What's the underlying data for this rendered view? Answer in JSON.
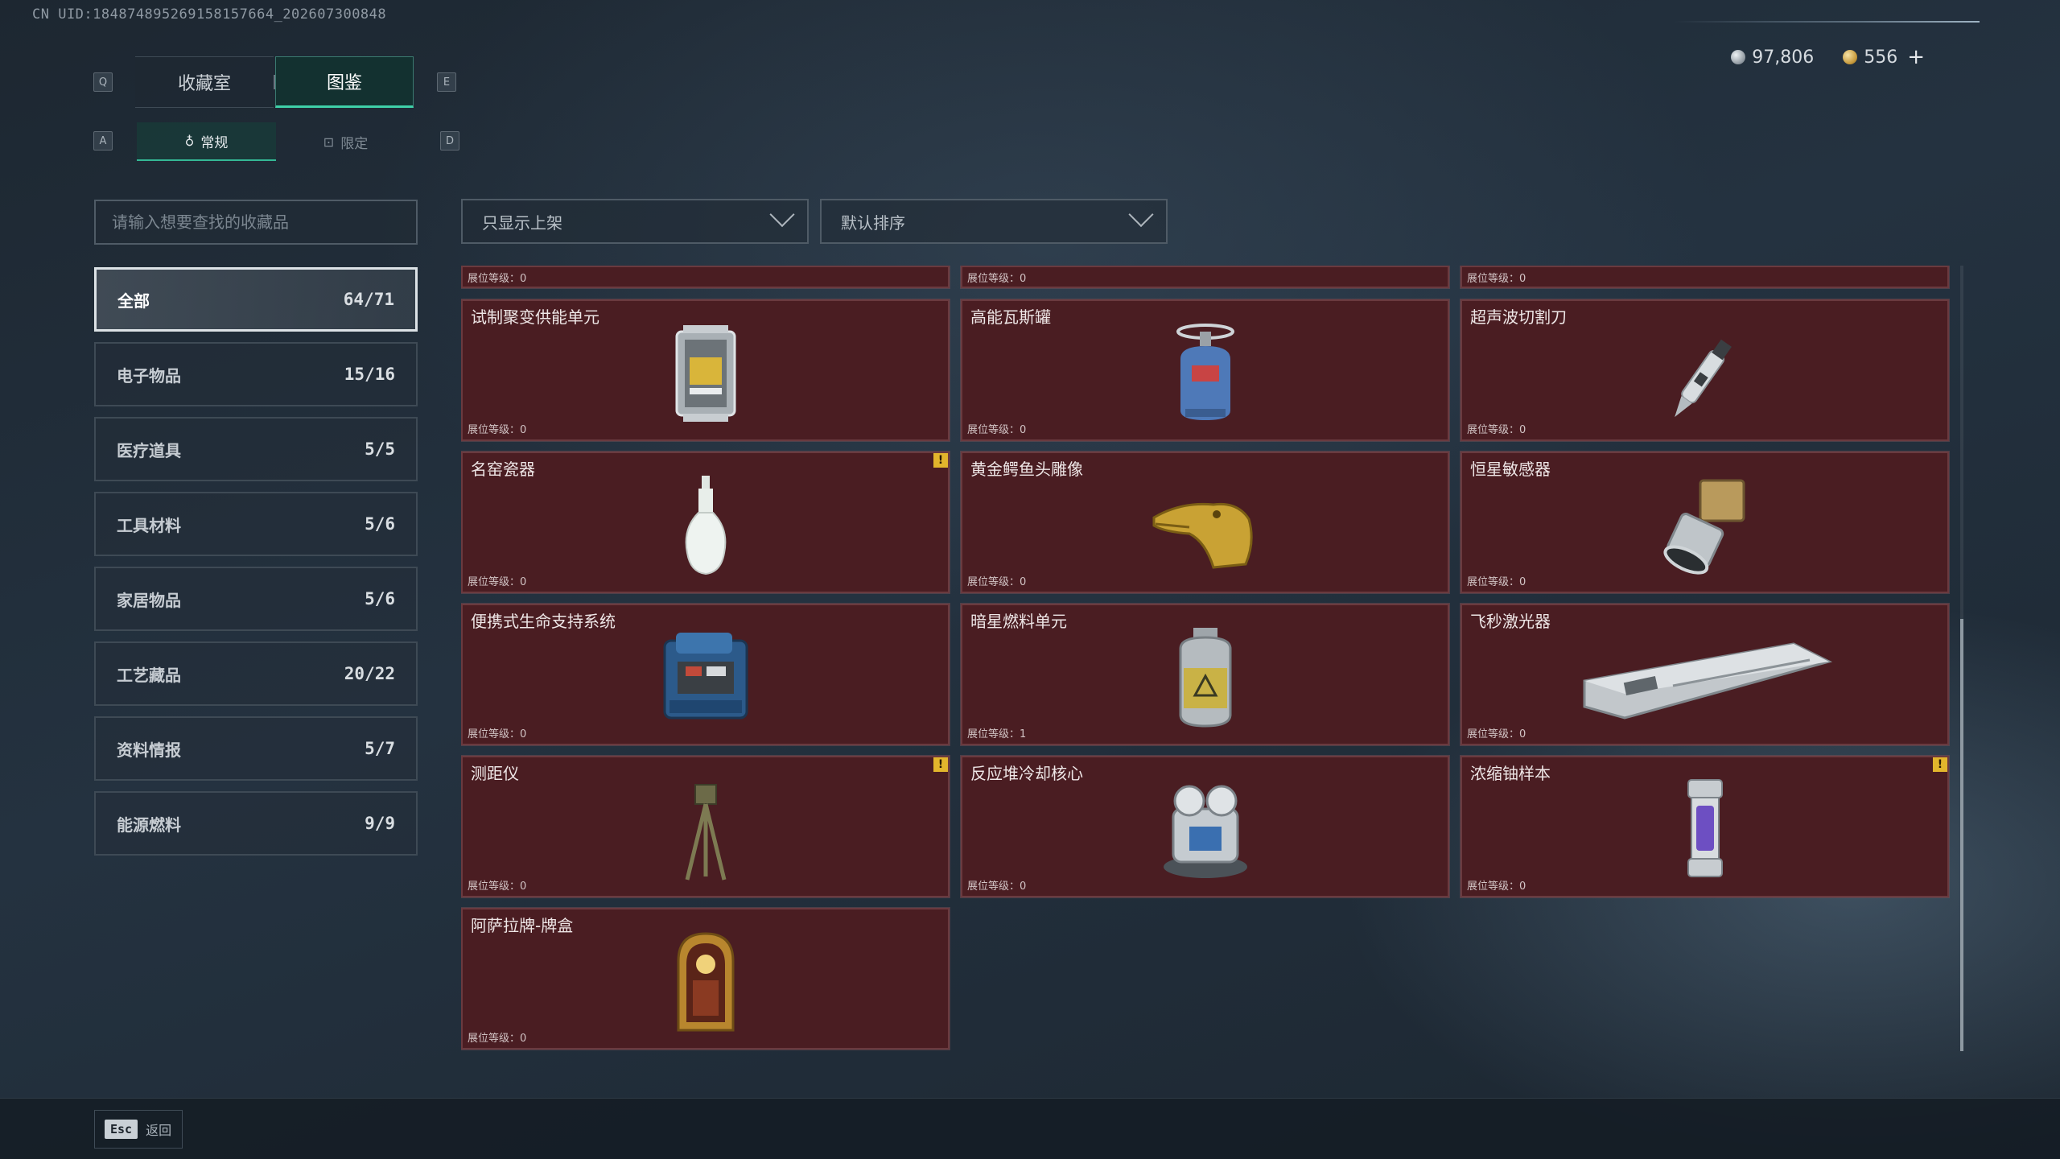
{
  "uid_text": "CN UID:18487489526915815766​4_202607300848",
  "currency": {
    "silver": "97,806",
    "gold": "556",
    "plus": "+"
  },
  "keys": {
    "q": "Q",
    "e": "E",
    "a": "A",
    "d": "D"
  },
  "top_tabs": [
    {
      "label": "收藏室",
      "active": false
    },
    {
      "label": "图鉴",
      "active": true
    }
  ],
  "sub_tabs": [
    {
      "label": "常规",
      "icon": "♁",
      "active": true
    },
    {
      "label": "限定",
      "icon": "⊡",
      "active": false
    }
  ],
  "search": {
    "placeholder": "请输入想要查找的收藏品"
  },
  "filters": {
    "shelf": "只显示上架",
    "sort": "默认排序"
  },
  "categories": [
    {
      "label": "全部",
      "count": "64/71",
      "active": true
    },
    {
      "label": "电子物品",
      "count": "15/16"
    },
    {
      "label": "医疗道具",
      "count": "5/5"
    },
    {
      "label": "工具材料",
      "count": "5/6"
    },
    {
      "label": "家居物品",
      "count": "5/6"
    },
    {
      "label": "工艺藏品",
      "count": "20/22"
    },
    {
      "label": "资料情报",
      "count": "5/7"
    },
    {
      "label": "能源燃料",
      "count": "9/9"
    }
  ],
  "level_label": "展位等级：",
  "partial_row": [
    {
      "level": "0"
    },
    {
      "level": "0"
    },
    {
      "level": "0"
    }
  ],
  "items": [
    {
      "name": "试制聚变供能单元",
      "level": "0",
      "icon": "fusion-unit-icon",
      "warn": false
    },
    {
      "name": "高能瓦斯罐",
      "level": "0",
      "icon": "gas-canister-icon",
      "warn": false
    },
    {
      "name": "超声波切割刀",
      "level": "0",
      "icon": "ultrasonic-knife-icon",
      "warn": false
    },
    {
      "name": "名窑瓷器",
      "level": "0",
      "icon": "porcelain-vase-icon",
      "warn": true
    },
    {
      "name": "黄金鳄鱼头雕像",
      "level": "0",
      "icon": "gold-crocodile-icon",
      "warn": false
    },
    {
      "name": "恒星敏感器",
      "level": "0",
      "icon": "star-sensor-icon",
      "warn": false
    },
    {
      "name": "便携式生命支持系统",
      "level": "0",
      "icon": "life-support-icon",
      "warn": false
    },
    {
      "name": "暗星燃料单元",
      "level": "1",
      "icon": "fuel-cell-icon",
      "warn": false
    },
    {
      "name": "飞秒激光器",
      "level": "0",
      "icon": "femto-laser-icon",
      "warn": false
    },
    {
      "name": "测距仪",
      "level": "0",
      "icon": "rangefinder-icon",
      "warn": true
    },
    {
      "name": "反应堆冷却核心",
      "level": "0",
      "icon": "reactor-core-icon",
      "warn": false
    },
    {
      "name": "浓缩铀样本",
      "level": "0",
      "icon": "uranium-sample-icon",
      "warn": true
    },
    {
      "name": "阿萨拉牌-牌盒",
      "level": "0",
      "icon": "card-box-icon",
      "warn": false
    }
  ],
  "warn_glyph": "!",
  "scroll": {
    "thumb_start_fraction": 0.45,
    "thumb_size_fraction": 0.55
  },
  "bottom": {
    "esc_key": "Esc",
    "esc_label": "返回"
  }
}
